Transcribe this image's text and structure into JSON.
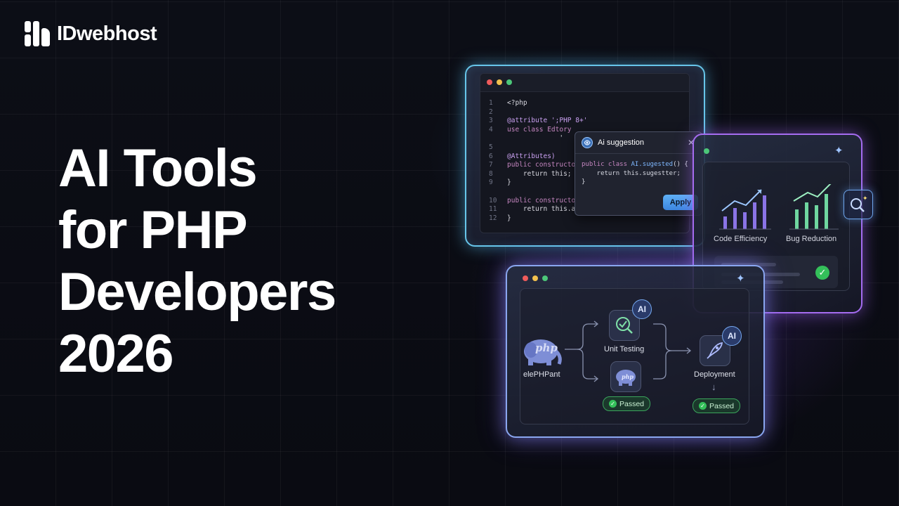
{
  "brand": {
    "name": "IDwebhost"
  },
  "headline": {
    "lines": [
      "AI Tools",
      "for PHP",
      "Developers",
      "2026"
    ]
  },
  "code_window": {
    "lines": [
      {
        "n": "1",
        "text": "<?php"
      },
      {
        "n": "2",
        "text": ""
      },
      {
        "n": "3",
        "text": "@attribute ';PHP 8+'"
      },
      {
        "n": "4",
        "text": "use class Edtory"
      },
      {
        "n": "",
        "text": "             '"
      },
      {
        "n": "5",
        "text": ""
      },
      {
        "n": "6",
        "text": "@Attributes)"
      },
      {
        "n": "7",
        "text": "public constructo"
      },
      {
        "n": "8",
        "text": "    return this;"
      },
      {
        "n": "9",
        "text": "}"
      },
      {
        "n": "",
        "text": ""
      },
      {
        "n": "10",
        "text": "public constructo"
      },
      {
        "n": "11",
        "text": "    return this.a"
      },
      {
        "n": "12",
        "text": "}"
      }
    ]
  },
  "ai_popup": {
    "title": "Ai suggestion",
    "close": "✕",
    "code_line1_a": "public class ",
    "code_line1_b": "AI.sugested",
    "code_line1_c": "() {",
    "code_line2": "    return this.sugestter;",
    "code_line3": "}",
    "apply_label": "Apply"
  },
  "stats_window": {
    "metric1": "Code Efficiency",
    "metric2": "Bug Reduction",
    "check": "✓"
  },
  "flow_window": {
    "source_label": "elePHPant",
    "php_text": "php",
    "unit_testing": "Unit Testing",
    "deployment": "Deployment",
    "ai_badge": "AI",
    "passed": "Passed",
    "arrow_down": "↓"
  },
  "colors": {
    "code_border": "#67c6ea",
    "stats_border": "#a56cf0",
    "flow_border": "#8aa6f0",
    "passed_green": "#34c05a"
  }
}
